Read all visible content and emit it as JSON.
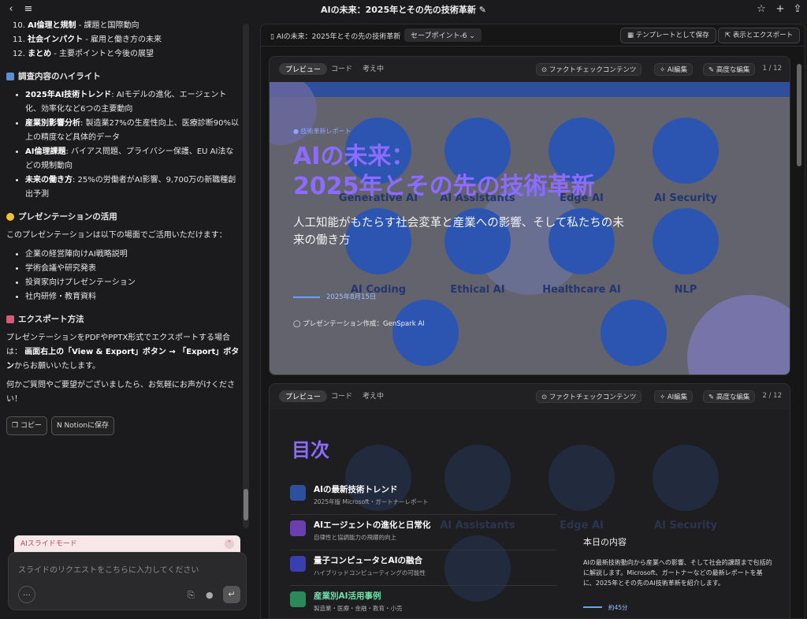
{
  "window": {
    "title": "AIの未来：2025年とその先の技術革新"
  },
  "chat": {
    "list_top": [
      {
        "num": "10.",
        "bold": "AI倫理と規制",
        "rest": " - 課題と国際動向"
      },
      {
        "num": "11.",
        "bold": "社会インパクト",
        "rest": " - 雇用と働き方の未来"
      },
      {
        "num": "12.",
        "bold": "まとめ",
        "rest": " - 主要ポイントと今後の展望"
      }
    ],
    "h_highlights": "調査内容のハイライト",
    "highlights": [
      {
        "bold": "2025年AI技術トレンド",
        "rest": ": AIモデルの進化、エージェント化、効率化など6つの主要動向"
      },
      {
        "bold": "産業別影響分析",
        "rest": ": 製造業27%の生産性向上、医療診断90%以上の精度など具体的データ"
      },
      {
        "bold": "AI倫理課題",
        "rest": ": バイアス問題、プライバシー保護、EU AI法などの規制動向"
      },
      {
        "bold": "未来の働き方",
        "rest": ": 25%の労働者がAI影響、9,700万の新職種創出予測"
      }
    ],
    "h_usage": "プレゼンテーションの活用",
    "usage_intro": "このプレゼンテーションは以下の場面でご活用いただけます：",
    "usage": [
      "企業の経営陣向けAI戦略説明",
      "学術会議や研究発表",
      "投資家向けプレゼンテーション",
      "社内研修・教育資料"
    ],
    "h_export": "エクスポート方法",
    "export_a": "プレゼンテーションをPDFやPPTX形式でエクスポートする場合は：",
    "export_b": "画面右上の「View & Export」ボタン → 「Export」ボタン",
    "export_c": "からお願いいたします。",
    "closing": "何かご質問やご要望がございましたら、お気軽にお声がけください！",
    "copy_label": "コピー",
    "notion_label": "Notionに保存"
  },
  "input": {
    "mode_label": "AIスライドモード",
    "placeholder": "スライドのリクエストをこちらに入力してください"
  },
  "right": {
    "doc_title": "AIの未来：2025年とその先の技術革新",
    "savepoint": "セーブポイント-6",
    "save_template": "テンプレートとして保存",
    "view_export": "表示とエクスポート"
  },
  "card_common": {
    "tab_preview": "プレビュー",
    "tab_code": "コード",
    "tab_think": "考え中",
    "factcheck": "ファクトチェックコンテンツ",
    "ai_edit": "AI編集",
    "adv_edit": "高度な編集"
  },
  "slide1": {
    "page": "1 / 12",
    "badge": "技術革新レポート",
    "title_l1": "AIの未来：",
    "title_l2": "2025年とその先の技術革新",
    "subtitle": "人工知能がもたらす社会変革と産業への影響、そして私たちの未来の働き方",
    "date": "2025年8月15日",
    "author": "プレゼンテーション作成：GenSpark AI",
    "bg_labels": [
      "Generative AI",
      "AI Assistants",
      "Edge AI",
      "AI Security",
      "AI Coding",
      "Ethical AI",
      "Healthcare AI",
      "NLP"
    ]
  },
  "slide2": {
    "page": "2 / 12",
    "title": "目次",
    "items": [
      {
        "t": "AIの最新技術トレンド",
        "s": "2025年版 Microsoft・ガートナーレポート"
      },
      {
        "t": "AIエージェントの進化と日常化",
        "s": "自律性と協調能力の飛躍的向上"
      },
      {
        "t": "量子コンピュータとAIの融合",
        "s": "ハイブリッドコンピューティングの可能性"
      },
      {
        "t": "産業別AI活用事例",
        "s": "製造業・医療・金融・教育・小売"
      }
    ],
    "bg_labels": [
      "AI Assistants",
      "Edge AI",
      "AI Security"
    ],
    "today_title": "本日の内容",
    "today_text": "AIの最新技術動向から産業への影響、そして社会的課題まで包括的に解説します。Microsoft、ガートナーなどの最新レポートを基に、2025年とその先のAI技術革新を紹介します。",
    "today_time": "約45分"
  }
}
